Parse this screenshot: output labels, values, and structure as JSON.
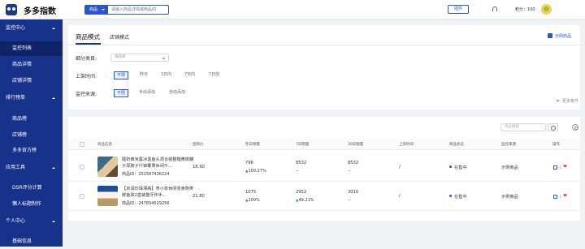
{
  "header": {
    "logo_text": "多多指数",
    "search_type": "商品",
    "search_placeholder": "请输入商品详情或商品ID",
    "plugin_button": "插件",
    "points_text": "积分：100"
  },
  "sidebar": {
    "groups": [
      {
        "label": "监控中心",
        "items": [
          {
            "label": "监控列表",
            "active": true
          },
          {
            "label": "商品详情"
          },
          {
            "label": "店铺详情"
          }
        ]
      },
      {
        "label": "排行榜单",
        "items": [
          {
            "label": "商品榜"
          },
          {
            "label": "店铺榜"
          },
          {
            "label": "多多官方榜"
          }
        ]
      },
      {
        "label": "应用工具",
        "items": [
          {
            "label": "DSR评分计算"
          },
          {
            "label": "懒人标题制作"
          }
        ]
      },
      {
        "label": "个人中心",
        "items": [
          {
            "label": "基础信息"
          }
        ]
      }
    ]
  },
  "filters": {
    "tabs": [
      {
        "label": "商品模式",
        "active": true
      },
      {
        "label": "店铺模式"
      }
    ],
    "example_toggle": "示例商品",
    "category_label": "细分类目:",
    "category_placeholder": "请选择",
    "time_label": "上架时间:",
    "time_options": [
      "不限",
      "昨日",
      "3日内",
      "7日内",
      "7日前"
    ],
    "source_label": "监控来源:",
    "source_options": [
      "不限",
      "手动添加",
      "自动添加"
    ],
    "more_filters": "更多条件"
  },
  "table": {
    "search_placeholder": "商品搜索",
    "columns": [
      "商品信息",
      "团购价",
      "昨日销量",
      "7日销量",
      "30日销量",
      "上架时间",
      "商品状态",
      "监控来源",
      "操作"
    ],
    "rows": [
      {
        "name": "酸奶西米露冰墨鱼头混合装整箱黄桃罐子尿脖子什锦椰果休闲午...",
        "id": "商品ID：231587436224",
        "price": "18.90",
        "yesterday": "796",
        "yesterday_change": "100.27%",
        "week": "8532",
        "week_change": "--",
        "month": "8532",
        "month_change": "--",
        "listed": "/",
        "status": "在售中",
        "source": "示例商品"
      },
      {
        "name": "【京润珍珠漂高】粤小泉休闲零食熊笑鲜鱼球2盒装整牙伴手...",
        "id": "商品ID：247834529256",
        "price": "21.80",
        "yesterday": "1075",
        "yesterday_change": "100%",
        "week": "2952",
        "week_change": "49.21%",
        "month": "3010",
        "month_change": "--",
        "listed": "/",
        "status": "在售中",
        "source": "示例商品"
      }
    ]
  },
  "colors": {
    "sidebar": "#17328a",
    "accent": "#2b55c9",
    "up": "#2c9c4a"
  }
}
